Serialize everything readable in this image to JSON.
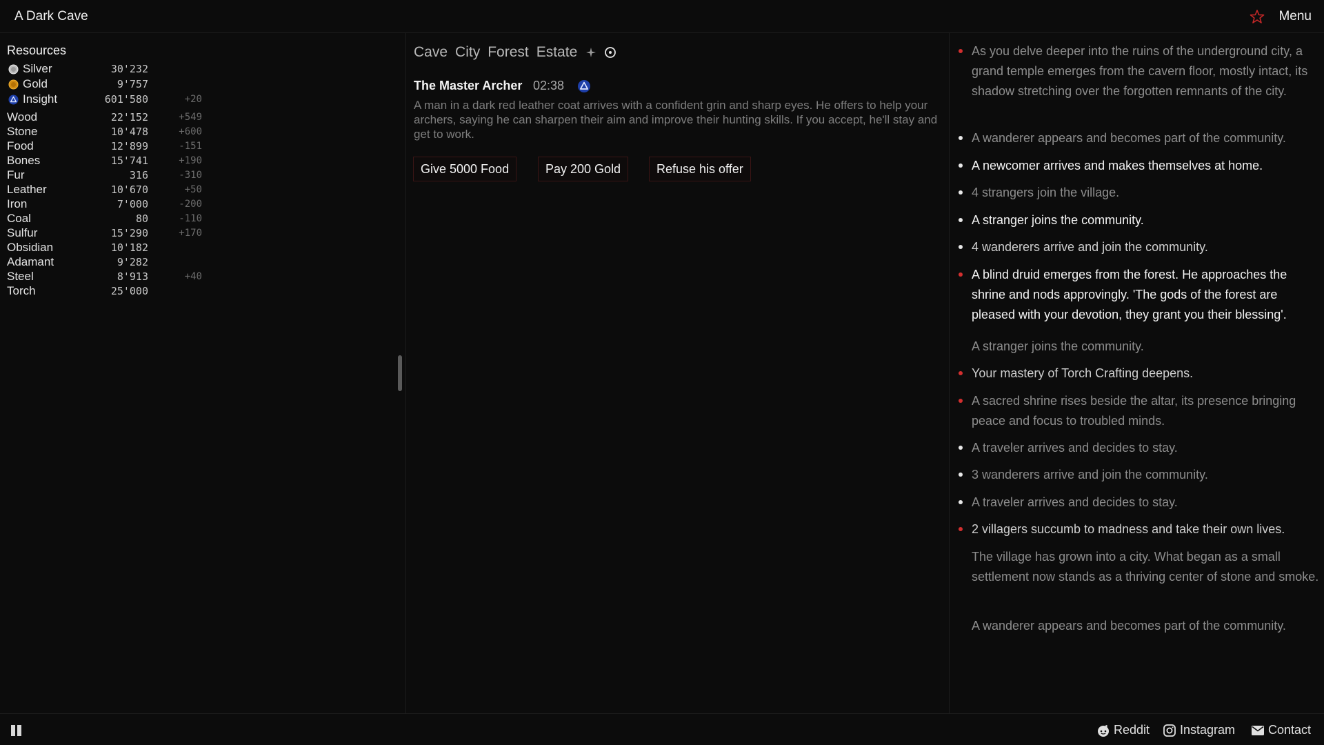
{
  "header": {
    "title": "A Dark Cave",
    "menu_label": "Menu",
    "star_color": "#c62828"
  },
  "resources": {
    "title": "Resources",
    "items": [
      {
        "name": "Silver",
        "amount": "30'232",
        "rate": "",
        "icon": "silver-coin-icon"
      },
      {
        "name": "Gold",
        "amount": "9'757",
        "rate": "",
        "icon": "gold-coin-icon"
      },
      {
        "name": "Insight",
        "amount": "601'580",
        "rate": "+20",
        "icon": "insight-icon"
      },
      {
        "name": "Wood",
        "amount": "22'152",
        "rate": "+549"
      },
      {
        "name": "Stone",
        "amount": "10'478",
        "rate": "+600"
      },
      {
        "name": "Food",
        "amount": "12'899",
        "rate": "-151"
      },
      {
        "name": "Bones",
        "amount": "15'741",
        "rate": "+190"
      },
      {
        "name": "Fur",
        "amount": "316",
        "rate": "-310"
      },
      {
        "name": "Leather",
        "amount": "10'670",
        "rate": "+50"
      },
      {
        "name": "Iron",
        "amount": "7'000",
        "rate": "-200"
      },
      {
        "name": "Coal",
        "amount": "80",
        "rate": "-110"
      },
      {
        "name": "Sulfur",
        "amount": "15'290",
        "rate": "+170"
      },
      {
        "name": "Obsidian",
        "amount": "10'182",
        "rate": ""
      },
      {
        "name": "Adamant",
        "amount": "9'282",
        "rate": ""
      },
      {
        "name": "Steel",
        "amount": "8'913",
        "rate": "+40"
      },
      {
        "name": "Torch",
        "amount": "25'000",
        "rate": ""
      }
    ]
  },
  "tabs": [
    "Cave",
    "City",
    "Forest",
    "Estate"
  ],
  "event": {
    "title": "The Master Archer",
    "timer": "02:38",
    "description": "A man in a dark red leather coat arrives with a confident grin and sharp eyes. He offers to help your archers, saying he can sharpen their aim and improve their hunting skills. If you accept, he'll stay and get to work.",
    "choices": [
      "Give 5000 Food",
      "Pay 200 Gold",
      "Refuse his offer"
    ]
  },
  "log": [
    {
      "text": "As you delve deeper into the ruins of the underground city, a grand temple emerges from the cavern floor, mostly intact, its shadow stretching over the forgotten remnants of the city.",
      "bullet": "red",
      "tone": "dim"
    },
    {
      "text": "A wanderer appears and becomes part of the community.",
      "bullet": "white",
      "tone": "dim"
    },
    {
      "text": "A newcomer arrives and makes themselves at home.",
      "bullet": "white",
      "tone": "bright"
    },
    {
      "text": "4 strangers join the village.",
      "bullet": "white",
      "tone": "dim"
    },
    {
      "text": "A stranger joins the community.",
      "bullet": "white",
      "tone": "bright"
    },
    {
      "text": "4 wanderers arrive and join the community.",
      "bullet": "white",
      "tone": "mid"
    },
    {
      "text": "A blind druid emerges from the forest. He approaches the shrine and nods approvingly. 'The gods of the forest are pleased with your devotion, they grant you their blessing'.",
      "bullet": "red",
      "tone": "bright"
    },
    {
      "text": "A stranger joins the community.",
      "bullet": "none",
      "tone": "dim"
    },
    {
      "text": "Your mastery of Torch Crafting deepens.",
      "bullet": "red",
      "tone": "mid"
    },
    {
      "text": "A sacred shrine rises beside the altar, its presence bringing peace and focus to troubled minds.",
      "bullet": "red",
      "tone": "dim"
    },
    {
      "text": "A traveler arrives and decides to stay.",
      "bullet": "white",
      "tone": "dim"
    },
    {
      "text": "3 wanderers arrive and join the community.",
      "bullet": "white",
      "tone": "dim"
    },
    {
      "text": "A traveler arrives and decides to stay.",
      "bullet": "white",
      "tone": "dim"
    },
    {
      "text": "2 villagers succumb to madness and take their own lives.",
      "bullet": "red",
      "tone": "mid"
    },
    {
      "text": "The village has grown into a city. What began as a small settlement now stands as a thriving center of stone and smoke.",
      "bullet": "none",
      "tone": "dim"
    },
    {
      "text": "A wanderer appears and becomes part of the community.",
      "bullet": "none",
      "tone": "dim"
    }
  ],
  "footer": {
    "reddit": "Reddit",
    "instagram": "Instagram",
    "contact": "Contact"
  },
  "colors": {
    "bullet_red": "#d32f2f",
    "bullet_white": "#e8e8e8",
    "bright": "#f2f2f2",
    "mid": "#cfcfcf",
    "dim": "#8d8d8d"
  }
}
